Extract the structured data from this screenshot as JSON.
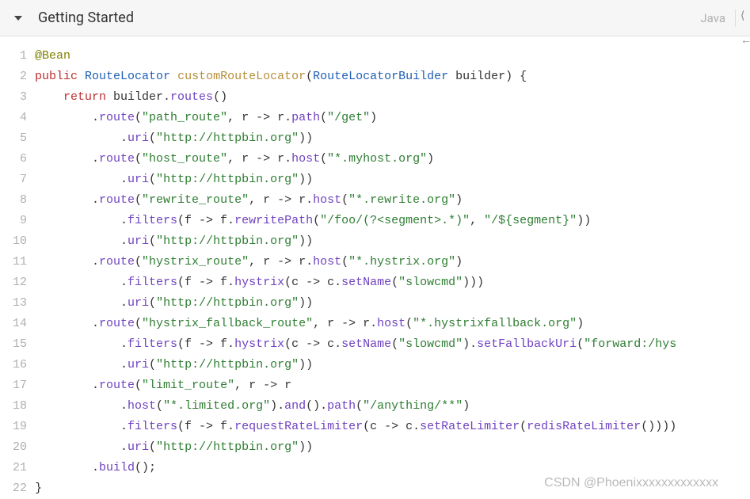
{
  "header": {
    "title": "Getting Started",
    "language": "Java"
  },
  "watermark": "CSDN @Phoenixxxxxxxxxxxxx",
  "colors": {
    "keyword_red": "#bd2f31",
    "annotation_olive": "#808000",
    "type_blue": "#1f5fb5",
    "method_purple": "#6f42c1",
    "declared_gold": "#b58f3b",
    "string_green": "#2e7d32",
    "plain": "#333333"
  },
  "code_lines": [
    [
      [
        "kw-olive",
        "@Bean"
      ]
    ],
    [
      [
        "kw-red",
        "public"
      ],
      [
        "p",
        " "
      ],
      [
        "ty",
        "RouteLocator"
      ],
      [
        "p",
        " "
      ],
      [
        "fn",
        "customRouteLocator"
      ],
      [
        "p",
        "("
      ],
      [
        "ty",
        "RouteLocatorBuilder"
      ],
      [
        "p",
        " builder) {"
      ]
    ],
    [
      [
        "p",
        "    "
      ],
      [
        "kw-red",
        "return"
      ],
      [
        "p",
        " builder."
      ],
      [
        "mt",
        "routes"
      ],
      [
        "p",
        "()"
      ]
    ],
    [
      [
        "p",
        "        ."
      ],
      [
        "mt",
        "route"
      ],
      [
        "p",
        "("
      ],
      [
        "st",
        "\"path_route\""
      ],
      [
        "p",
        ", r -> r."
      ],
      [
        "mt",
        "path"
      ],
      [
        "p",
        "("
      ],
      [
        "st",
        "\"/get\""
      ],
      [
        "p",
        ")"
      ]
    ],
    [
      [
        "p",
        "            ."
      ],
      [
        "mt",
        "uri"
      ],
      [
        "p",
        "("
      ],
      [
        "st",
        "\"http://httpbin.org\""
      ],
      [
        "p",
        "))"
      ]
    ],
    [
      [
        "p",
        "        ."
      ],
      [
        "mt",
        "route"
      ],
      [
        "p",
        "("
      ],
      [
        "st",
        "\"host_route\""
      ],
      [
        "p",
        ", r -> r."
      ],
      [
        "mt",
        "host"
      ],
      [
        "p",
        "("
      ],
      [
        "st",
        "\"*.myhost.org\""
      ],
      [
        "p",
        ")"
      ]
    ],
    [
      [
        "p",
        "            ."
      ],
      [
        "mt",
        "uri"
      ],
      [
        "p",
        "("
      ],
      [
        "st",
        "\"http://httpbin.org\""
      ],
      [
        "p",
        "))"
      ]
    ],
    [
      [
        "p",
        "        ."
      ],
      [
        "mt",
        "route"
      ],
      [
        "p",
        "("
      ],
      [
        "st",
        "\"rewrite_route\""
      ],
      [
        "p",
        ", r -> r."
      ],
      [
        "mt",
        "host"
      ],
      [
        "p",
        "("
      ],
      [
        "st",
        "\"*.rewrite.org\""
      ],
      [
        "p",
        ")"
      ]
    ],
    [
      [
        "p",
        "            ."
      ],
      [
        "mt",
        "filters"
      ],
      [
        "p",
        "(f -> f."
      ],
      [
        "mt",
        "rewritePath"
      ],
      [
        "p",
        "("
      ],
      [
        "st",
        "\"/foo/(?<segment>.*)\""
      ],
      [
        "p",
        ", "
      ],
      [
        "st",
        "\"/${segment}\""
      ],
      [
        "p",
        "))"
      ]
    ],
    [
      [
        "p",
        "            ."
      ],
      [
        "mt",
        "uri"
      ],
      [
        "p",
        "("
      ],
      [
        "st",
        "\"http://httpbin.org\""
      ],
      [
        "p",
        "))"
      ]
    ],
    [
      [
        "p",
        "        ."
      ],
      [
        "mt",
        "route"
      ],
      [
        "p",
        "("
      ],
      [
        "st",
        "\"hystrix_route\""
      ],
      [
        "p",
        ", r -> r."
      ],
      [
        "mt",
        "host"
      ],
      [
        "p",
        "("
      ],
      [
        "st",
        "\"*.hystrix.org\""
      ],
      [
        "p",
        ")"
      ]
    ],
    [
      [
        "p",
        "            ."
      ],
      [
        "mt",
        "filters"
      ],
      [
        "p",
        "(f -> f."
      ],
      [
        "mt",
        "hystrix"
      ],
      [
        "p",
        "(c -> c."
      ],
      [
        "mt",
        "setName"
      ],
      [
        "p",
        "("
      ],
      [
        "st",
        "\"slowcmd\""
      ],
      [
        "p",
        ")))"
      ]
    ],
    [
      [
        "p",
        "            ."
      ],
      [
        "mt",
        "uri"
      ],
      [
        "p",
        "("
      ],
      [
        "st",
        "\"http://httpbin.org\""
      ],
      [
        "p",
        "))"
      ]
    ],
    [
      [
        "p",
        "        ."
      ],
      [
        "mt",
        "route"
      ],
      [
        "p",
        "("
      ],
      [
        "st",
        "\"hystrix_fallback_route\""
      ],
      [
        "p",
        ", r -> r."
      ],
      [
        "mt",
        "host"
      ],
      [
        "p",
        "("
      ],
      [
        "st",
        "\"*.hystrixfallback.org\""
      ],
      [
        "p",
        ")"
      ]
    ],
    [
      [
        "p",
        "            ."
      ],
      [
        "mt",
        "filters"
      ],
      [
        "p",
        "(f -> f."
      ],
      [
        "mt",
        "hystrix"
      ],
      [
        "p",
        "(c -> c."
      ],
      [
        "mt",
        "setName"
      ],
      [
        "p",
        "("
      ],
      [
        "st",
        "\"slowcmd\""
      ],
      [
        "p",
        ")."
      ],
      [
        "mt",
        "setFallbackUri"
      ],
      [
        "p",
        "("
      ],
      [
        "st",
        "\"forward:/hys"
      ]
    ],
    [
      [
        "p",
        "            ."
      ],
      [
        "mt",
        "uri"
      ],
      [
        "p",
        "("
      ],
      [
        "st",
        "\"http://httpbin.org\""
      ],
      [
        "p",
        "))"
      ]
    ],
    [
      [
        "p",
        "        ."
      ],
      [
        "mt",
        "route"
      ],
      [
        "p",
        "("
      ],
      [
        "st",
        "\"limit_route\""
      ],
      [
        "p",
        ", r -> r"
      ]
    ],
    [
      [
        "p",
        "            ."
      ],
      [
        "mt",
        "host"
      ],
      [
        "p",
        "("
      ],
      [
        "st",
        "\"*.limited.org\""
      ],
      [
        "p",
        ")."
      ],
      [
        "mt",
        "and"
      ],
      [
        "p",
        "()."
      ],
      [
        "mt",
        "path"
      ],
      [
        "p",
        "("
      ],
      [
        "st",
        "\"/anything/**\""
      ],
      [
        "p",
        ")"
      ]
    ],
    [
      [
        "p",
        "            ."
      ],
      [
        "mt",
        "filters"
      ],
      [
        "p",
        "(f -> f."
      ],
      [
        "mt",
        "requestRateLimiter"
      ],
      [
        "p",
        "(c -> c."
      ],
      [
        "mt",
        "setRateLimiter"
      ],
      [
        "p",
        "("
      ],
      [
        "mt",
        "redisRateLimiter"
      ],
      [
        "p",
        "())))"
      ]
    ],
    [
      [
        "p",
        "            ."
      ],
      [
        "mt",
        "uri"
      ],
      [
        "p",
        "("
      ],
      [
        "st",
        "\"http://httpbin.org\""
      ],
      [
        "p",
        "))"
      ]
    ],
    [
      [
        "p",
        "        ."
      ],
      [
        "mt",
        "build"
      ],
      [
        "p",
        "();"
      ]
    ],
    [
      [
        "p",
        "}"
      ]
    ]
  ]
}
